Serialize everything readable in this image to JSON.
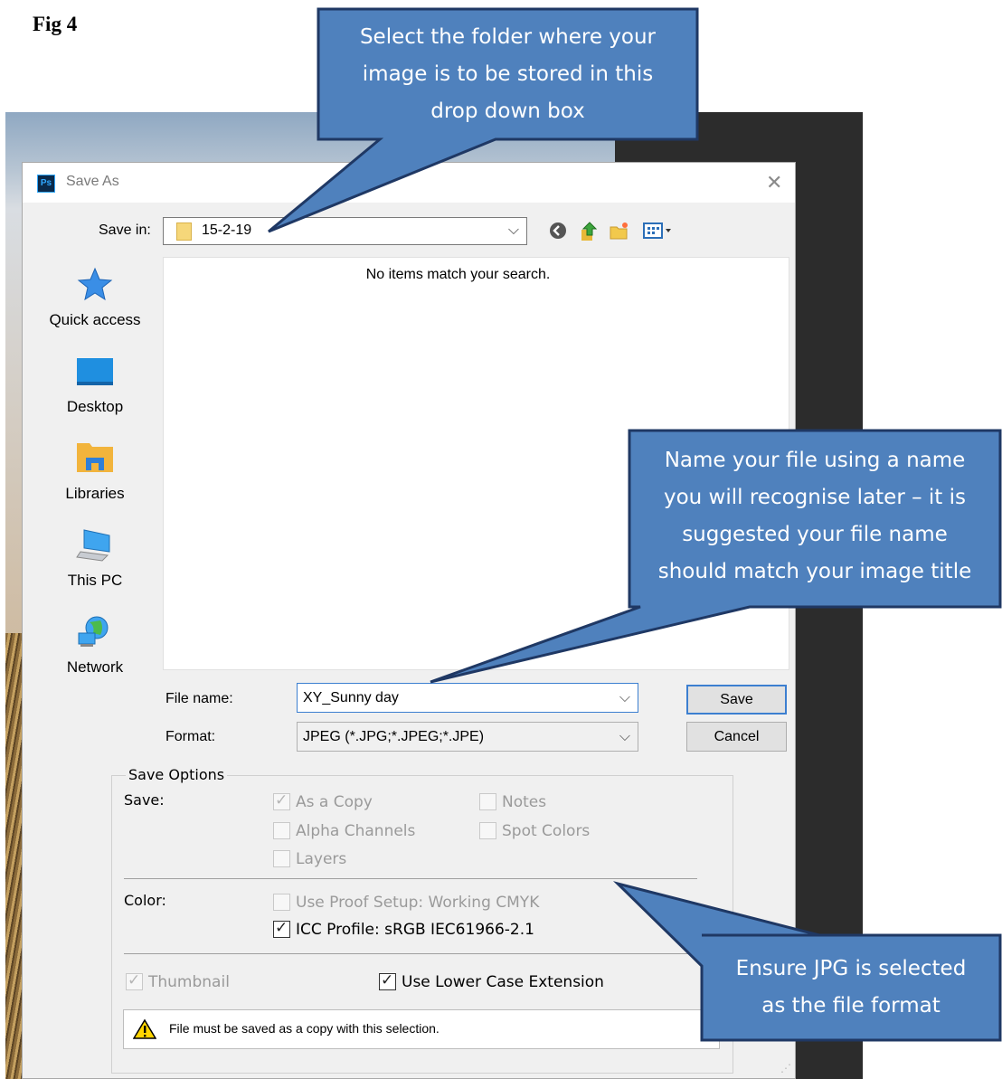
{
  "figure_label": "Fig 4",
  "dialog": {
    "app_icon_text": "Ps",
    "title": "Save As",
    "save_in_label": "Save in:",
    "save_in_value": "15-2-19",
    "empty_message": "No items match your search.",
    "places": [
      {
        "label": "Quick access",
        "icon": "star-icon"
      },
      {
        "label": "Desktop",
        "icon": "desktop-icon"
      },
      {
        "label": "Libraries",
        "icon": "libraries-icon"
      },
      {
        "label": "This PC",
        "icon": "computer-icon"
      },
      {
        "label": "Network",
        "icon": "network-icon"
      }
    ],
    "file_name_label": "File name:",
    "file_name_value": "XY_Sunny day",
    "format_label": "Format:",
    "format_value": "JPEG (*.JPG;*.JPEG;*.JPE)",
    "save_button": "Save",
    "cancel_button": "Cancel"
  },
  "save_options": {
    "title": "Save Options",
    "save_label": "Save:",
    "as_a_copy": {
      "label": "As a Copy",
      "checked": true,
      "enabled": false
    },
    "notes": {
      "label": "Notes",
      "checked": false,
      "enabled": false
    },
    "alpha_channels": {
      "label": "Alpha Channels",
      "checked": false,
      "enabled": false
    },
    "spot_colors": {
      "label": "Spot Colors",
      "checked": false,
      "enabled": false
    },
    "layers": {
      "label": "Layers",
      "checked": false,
      "enabled": false
    },
    "color_label": "Color:",
    "use_proof_setup": {
      "label": "Use Proof Setup:  Working CMYK",
      "checked": false,
      "enabled": false
    },
    "icc_profile": {
      "label": "ICC Profile:  sRGB IEC61966-2.1",
      "checked": true,
      "enabled": true
    },
    "thumbnail": {
      "label": "Thumbnail",
      "checked": true,
      "enabled": false
    },
    "lower_case_ext": {
      "label": "Use Lower Case Extension",
      "checked": true,
      "enabled": true
    },
    "warning": "File must be saved as a copy with this selection."
  },
  "callouts": {
    "folder": [
      "Select the folder where your",
      "image is to be stored in this",
      "drop down box"
    ],
    "file_name": [
      "Name your file using a name",
      "you will recognise later – it is",
      "suggested your file name",
      "should match your image title"
    ],
    "format": [
      "Ensure JPG is selected",
      "as the file format"
    ]
  },
  "colors": {
    "callout_fill": "#4f81bd",
    "callout_border": "#1f3864",
    "accent": "#3c7fd0"
  }
}
